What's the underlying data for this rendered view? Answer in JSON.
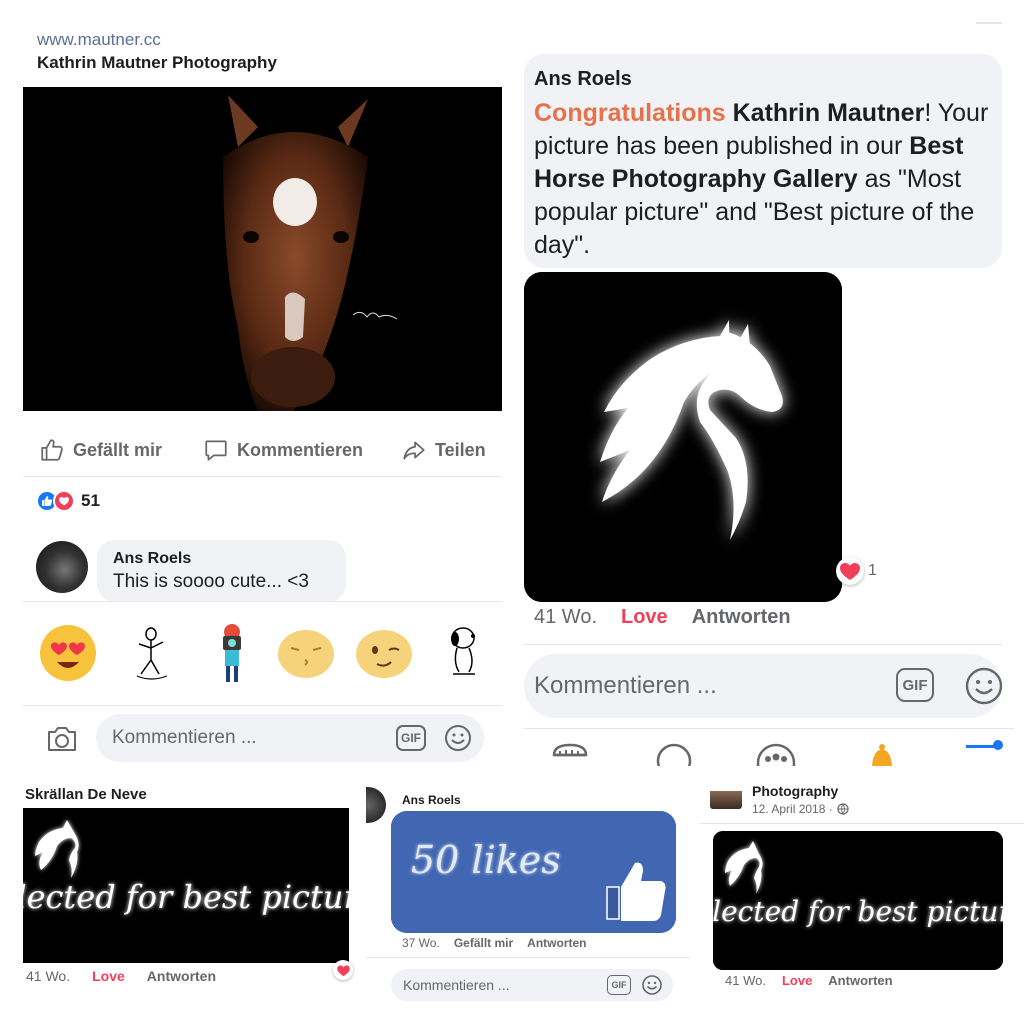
{
  "post": {
    "url": "www.mautner.cc",
    "page_name": "Kathrin Mautner Photography",
    "actions": {
      "like": "Gefällt mir",
      "comment": "Kommentieren",
      "share": "Teilen"
    },
    "reaction_count": "51",
    "comment": {
      "author": "Ans Roels",
      "text": "This is soooo cute... <3"
    },
    "composer_placeholder": "Kommentieren ...",
    "gif_label": "GIF"
  },
  "reply": {
    "author": "Ans Roels",
    "highlight": "Congratulations",
    "name": "Kathrin Mautner",
    "text_1": "! Your picture has been published in our ",
    "gallery": "Best Horse Photography Gallery",
    "text_2": " as \"Most popular picture\" and \"Best picture of the day\".",
    "love_count": "1",
    "time": "41 Wo.",
    "love_label": "Love",
    "reply_label": "Antworten",
    "composer_placeholder": "Kommentieren ...",
    "gif_label": "GIF"
  },
  "bottom_left": {
    "author": "Skrällan De Neve",
    "image_text": "Selected for best picture!",
    "time": "41 Wo.",
    "love_label": "Love",
    "reply_label": "Antworten"
  },
  "bottom_middle": {
    "author": "Ans Roels",
    "image_text": "50 likes",
    "time": "37 Wo.",
    "like_label": "Gefällt mir",
    "reply_label": "Antworten",
    "composer_placeholder": "Kommentieren ...",
    "gif_label": "GIF"
  },
  "bottom_right": {
    "author": "Photography",
    "date": "12. April 2018 ·",
    "image_text": "Selected for best picture!",
    "time": "41 Wo.",
    "love_label": "Love",
    "reply_label": "Antworten"
  },
  "colors": {
    "facebook_blue": "#1877f2",
    "love_red": "#f33e58",
    "highlight_orange": "#e8704a",
    "card_blue": "#4267b2"
  }
}
